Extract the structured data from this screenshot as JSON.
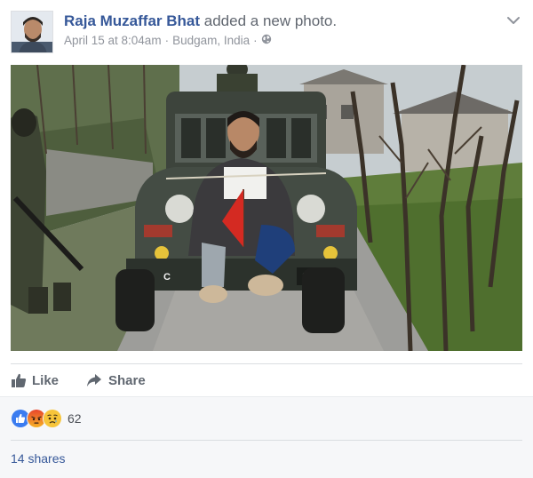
{
  "post": {
    "author_name": "Raja Muzaffar Bhat",
    "action_text": "added a new photo.",
    "timestamp": "April 15 at 8:04am",
    "separator": "·",
    "location": "Budgam, India",
    "privacy_icon": "globe-icon",
    "options_icon": "chevron-down-icon",
    "photo_plate": "339v",
    "photo_plate_small": "C"
  },
  "actions": {
    "like_label": "Like",
    "share_label": "Share"
  },
  "reactions": {
    "icons": [
      "like-reaction-icon",
      "angry-reaction-icon",
      "sad-reaction-icon"
    ],
    "count": "62"
  },
  "shares": {
    "label": "14 shares"
  },
  "colors": {
    "link_blue": "#365899",
    "meta_gray": "#90949c",
    "action_gray": "#606770",
    "footer_bg": "#f6f7f9"
  }
}
